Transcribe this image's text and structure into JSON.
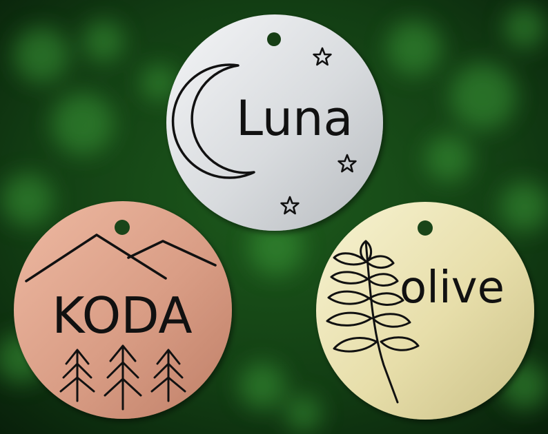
{
  "background": {
    "description_color": "#0f3a12",
    "bokeh_color": "#2f8a2e"
  },
  "tags": [
    {
      "name": "Luna",
      "metal": "aluminum",
      "color_light": "#eef0f2",
      "color_dark": "#b9bdc2",
      "icons": [
        "crescent-moon-icon",
        "star-icon",
        "star-icon",
        "star-icon"
      ]
    },
    {
      "name": "KODA",
      "metal": "copper",
      "color_light": "#eab39b",
      "color_dark": "#c3826a",
      "icons": [
        "mountains-icon",
        "pine-tree-icon",
        "pine-tree-icon",
        "pine-tree-icon"
      ]
    },
    {
      "name": "olive",
      "metal": "brass",
      "color_light": "#f4efc7",
      "color_dark": "#cfc58a",
      "icons": [
        "olive-branch-icon"
      ]
    }
  ]
}
